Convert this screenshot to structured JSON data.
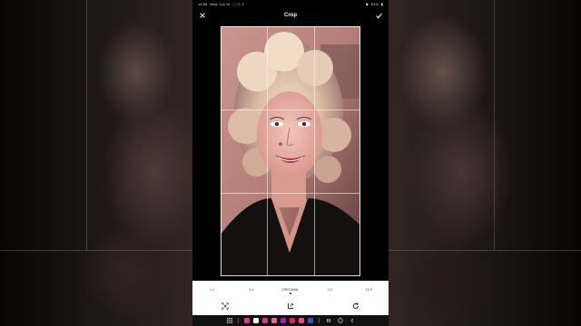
{
  "status_bar": {
    "time": "14:58",
    "date": "Wed, Jun 14",
    "right_status": "81%"
  },
  "app_bar": {
    "title": "Crop",
    "close_icon": "close-icon",
    "confirm_icon": "check-icon"
  },
  "aspect_ratios": [
    {
      "label": "1:1",
      "selected": false
    },
    {
      "label": "3:4",
      "selected": false
    },
    {
      "label": "ORIGINAL",
      "selected": true
    },
    {
      "label": "3:2",
      "selected": false
    },
    {
      "label": "16:9",
      "selected": false
    }
  ],
  "tools": [
    "free-crop-icon",
    "transform-icon",
    "rotate-icon"
  ],
  "dock_apps": [
    {
      "name": "app-1",
      "color": "#e6338a"
    },
    {
      "name": "app-2",
      "color": "#f5f5f5"
    },
    {
      "name": "app-3",
      "color": "#d63a8f"
    },
    {
      "name": "app-4",
      "color": "#f06292"
    },
    {
      "name": "app-5",
      "color": "#9c27b0"
    },
    {
      "name": "app-6",
      "color": "#e91e63"
    },
    {
      "name": "app-7",
      "color": "#ff4081"
    },
    {
      "name": "app-8",
      "color": "#3f51b5"
    }
  ],
  "colors": {
    "panel": "#ffffff",
    "screen_bg": "#000000"
  }
}
